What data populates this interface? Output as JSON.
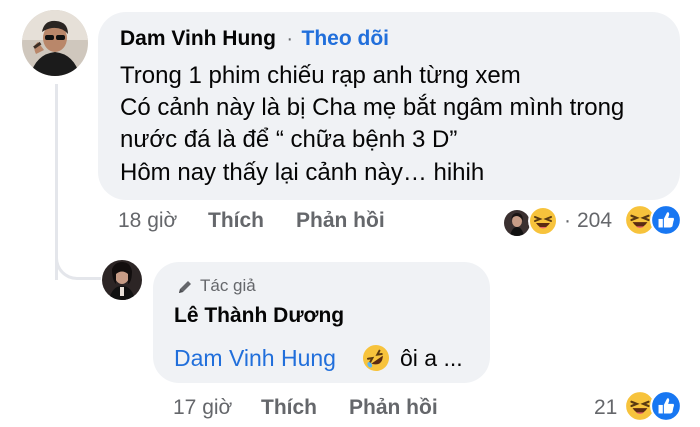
{
  "comment": {
    "author": "Dam Vinh Hung",
    "separator": "·",
    "follow_label": "Theo dõi",
    "lines": [
      "Trong 1 phim chiếu rạp anh từng xem",
      "Có cảnh này là bị Cha mẹ bắt ngâm mình trong",
      "nước đá là để “ chữa bệnh 3 D”",
      "Hôm nay thấy lại cảnh này… hihih"
    ],
    "time": "18 giờ",
    "like_label": "Thích",
    "reply_label": "Phản hồi",
    "reaction_separator": "·",
    "reaction_count": "204",
    "reaction_icons": [
      "laughing-emoji",
      "like-thumb"
    ]
  },
  "reply": {
    "badge_icon": "pencil-icon",
    "badge_label": "Tác giả",
    "author": "Lê Thành Dương",
    "mention": "Dam Vinh Hung",
    "emoji": "rofl-emoji",
    "text": "ôi a ...",
    "time": "17 giờ",
    "like_label": "Thích",
    "reply_label": "Phản hồi",
    "reaction_count": "21",
    "reaction_icons": [
      "laughing-emoji",
      "like-thumb"
    ]
  },
  "colors": {
    "bubble": "#f0f2f5",
    "link": "#216fdb",
    "meta": "#65676b",
    "like": "#1877f2"
  }
}
